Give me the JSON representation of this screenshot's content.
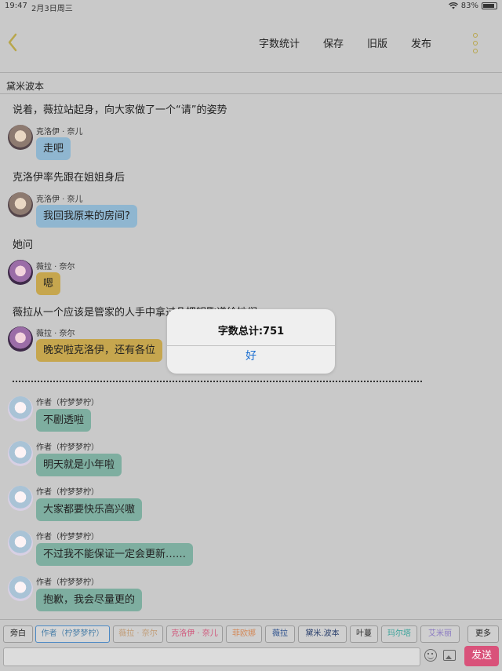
{
  "status": {
    "time": "19:47",
    "date": "2月3日周三",
    "battery": "83%"
  },
  "toolbar": {
    "word_count": "字数统计",
    "save": "保存",
    "old_version": "旧版",
    "publish": "发布"
  },
  "doc": {
    "title": "黛米波本"
  },
  "messages": [
    {
      "type": "narration",
      "text": "说着，薇拉站起身，向大家做了一个“请”的姿势"
    },
    {
      "type": "chat",
      "speaker": "克洛伊 · 奈儿",
      "text": "走吧",
      "style": "blue"
    },
    {
      "type": "narration",
      "text": "克洛伊率先跟在姐姐身后"
    },
    {
      "type": "chat",
      "speaker": "克洛伊 · 奈儿",
      "text": "我回我原来的房间?",
      "style": "blue"
    },
    {
      "type": "narration",
      "text": "她问"
    },
    {
      "type": "chat",
      "speaker": "薇拉 · 奈尔",
      "text": "嗯",
      "style": "gold"
    },
    {
      "type": "narration",
      "text": "薇拉从一个应该是管家的人手中拿过几把钥匙递给她们"
    },
    {
      "type": "chat",
      "speaker": "薇拉 · 奈尔",
      "text": "晚安啦克洛伊，还有各位",
      "style": "gold"
    },
    {
      "type": "chat",
      "speaker": "作者（柠梦梦柠）",
      "text": "不剧透啦",
      "style": "teal"
    },
    {
      "type": "chat",
      "speaker": "作者（柠梦梦柠）",
      "text": "明天就是小年啦",
      "style": "teal"
    },
    {
      "type": "chat",
      "speaker": "作者（柠梦梦柠）",
      "text": "大家都要快乐高兴嗷",
      "style": "teal"
    },
    {
      "type": "chat",
      "speaker": "作者（柠梦梦柠）",
      "text": "不过我不能保证一定会更新……",
      "style": "teal"
    },
    {
      "type": "chat",
      "speaker": "作者（柠梦梦柠）",
      "text": "抱歉，我会尽量更的",
      "style": "teal"
    }
  ],
  "alert": {
    "message": "字数总计:751",
    "ok": "好"
  },
  "roles": [
    {
      "label": "旁白",
      "color": "#222222"
    },
    {
      "label": "作者（柠梦梦柠）",
      "color": "#4a7fa8"
    },
    {
      "label": "薇拉 · 奈尔",
      "color": "#c19b74"
    },
    {
      "label": "克洛伊 · 奈儿",
      "color": "#d0557a"
    },
    {
      "label": "菲欧娜",
      "color": "#d38a5a"
    },
    {
      "label": "薇拉",
      "color": "#2a4f8c"
    },
    {
      "label": "黛米.波本",
      "color": "#2a3f6c"
    },
    {
      "label": "叶蔓",
      "color": "#333333"
    },
    {
      "label": "玛尔塔",
      "color": "#3aa39a"
    },
    {
      "label": "艾米丽",
      "color": "#8a79c2"
    },
    {
      "label": "更多",
      "color": "#222222"
    }
  ],
  "composer": {
    "placeholder": "",
    "send": "发送"
  },
  "colors": {
    "accent_ok": "#1b6fd1",
    "send_bg": "#d9527a",
    "back_arrow": "#b8a64b"
  }
}
